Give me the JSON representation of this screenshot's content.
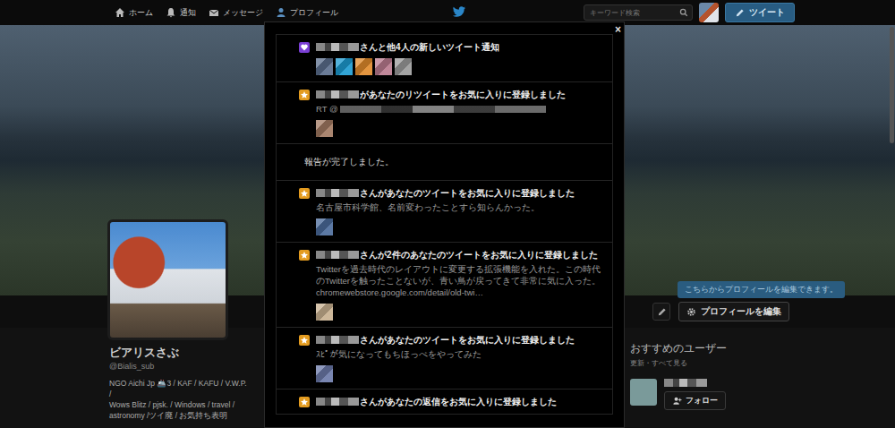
{
  "topbar": {
    "nav": [
      {
        "label": "ホーム",
        "kind": "home"
      },
      {
        "label": "通知",
        "kind": "bell"
      },
      {
        "label": "メッセージ",
        "kind": "mail"
      },
      {
        "label": "プロフィール",
        "kind": "person"
      }
    ],
    "search": {
      "placeholder": "キーワード検索"
    },
    "tweet_button": "ツイート"
  },
  "profile": {
    "name": "ビアリスさぶ",
    "handle": "@Bialis_sub",
    "bio_lines": [
      "NGO Aichi Jp 🚢3 / KAF / KAFU / V.W.P.",
      "/",
      "Wows Blitz / pjsk. / Windows / travel /",
      "astronomy /ツイ廃 / お気持ち表明"
    ]
  },
  "edit": {
    "tooltip": "こちらからプロフィールを編集できます。",
    "button": "プロフィールを編集"
  },
  "suggestions": {
    "title": "おすすめのユーザー",
    "links": "更新・すべて見る",
    "users": [
      {
        "name_masked": true,
        "follow": "フォロー"
      }
    ]
  },
  "modal": {
    "close": "×",
    "notifications": [
      {
        "kind": "tweets",
        "actor_masked": true,
        "title": "さんと他4人の新しいツイート通知",
        "body": [],
        "avatars": [
          "#5a6d8c",
          "#1b9ad0",
          "#e0892a",
          "#b97a8e",
          "#9a9a9a"
        ]
      },
      {
        "kind": "favorite",
        "actor_masked": true,
        "title": "があなたのリツイートをお気に入りに登録しました",
        "body": [
          {
            "text": "RT @",
            "masked": true
          }
        ],
        "avatars": [
          "#a07860"
        ]
      },
      {
        "kind": "plain",
        "actor_masked": false,
        "title": "報告が完了しました。",
        "body": [],
        "avatars": []
      },
      {
        "kind": "favorite",
        "actor_masked": true,
        "title": "さんがあなたのツイートをお気に入りに登録しました",
        "body": [
          {
            "text": "名古屋市科学館、名前変わったことすら知らんかった。",
            "masked": false
          }
        ],
        "avatars": [
          "#4a6a9a"
        ]
      },
      {
        "kind": "favorite",
        "actor_masked": true,
        "title": "さんが2件のあなたのツイートをお気に入りに登録しました",
        "body": [
          {
            "text": "Twitterを過去時代のレイアウトに変更する拡張機能を入れた。この時代のTwitterを触ったことないが、青い鳥が戻ってきて非常に気に入った。",
            "masked": false
          },
          {
            "text": "chromewebstore.google.com/detail/old-twi…",
            "masked": false
          }
        ],
        "avatars": [
          "#c8b090"
        ]
      },
      {
        "kind": "favorite",
        "actor_masked": true,
        "title": "さんがあなたのツイートをお気に入りに登録しました",
        "body": [
          {
            "text": "ｽﾋﾟが気になってもちほっぺをやってみた",
            "masked": false
          }
        ],
        "avatars": [
          "#6a78a8"
        ]
      },
      {
        "kind": "favorite",
        "actor_masked": true,
        "title": "さんがあなたの返信をお気に入りに登録しました",
        "body": [],
        "avatars": []
      }
    ]
  }
}
